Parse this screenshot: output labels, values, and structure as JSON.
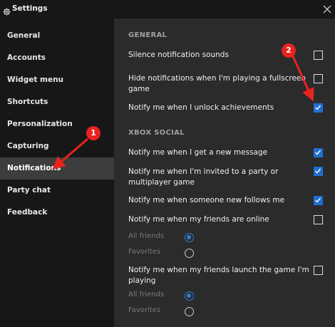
{
  "window": {
    "title": "Settings",
    "icon": "gear-icon",
    "close_icon": "close-icon"
  },
  "sidebar": {
    "items": [
      {
        "label": "General"
      },
      {
        "label": "Accounts"
      },
      {
        "label": "Widget menu"
      },
      {
        "label": "Shortcuts"
      },
      {
        "label": "Personalization"
      },
      {
        "label": "Capturing"
      },
      {
        "label": "Notifications",
        "active": true
      },
      {
        "label": "Party chat"
      },
      {
        "label": "Feedback"
      }
    ]
  },
  "general": {
    "header": "GENERAL",
    "options": [
      {
        "label": "Silence notification sounds",
        "checked": false
      },
      {
        "label": "Hide notifications when I'm playing a fullscreen game",
        "checked": false
      },
      {
        "label": "Notify me when I unlock achievements",
        "checked": true
      }
    ]
  },
  "xbox_social": {
    "header": "XBOX SOCIAL",
    "options": [
      {
        "label": "Notify me when I get a new message",
        "checked": true
      },
      {
        "label": "Notify me when I'm invited to a party or multiplayer game",
        "checked": true
      },
      {
        "label": "Notify me when someone new follows me",
        "checked": true
      },
      {
        "label": "Notify me when my friends are online",
        "checked": false
      },
      {
        "label": "Notify me when my friends launch the game I'm playing",
        "checked": false
      }
    ],
    "online_radios": [
      {
        "label": "All friends",
        "selected": true
      },
      {
        "label": "Favorites",
        "selected": false
      }
    ],
    "launch_radios": [
      {
        "label": "All friends",
        "selected": true
      },
      {
        "label": "Favorites",
        "selected": false
      }
    ]
  },
  "annotations": [
    {
      "number": "1"
    },
    {
      "number": "2"
    }
  ],
  "colors": {
    "accent": "#1e6fd0",
    "annotation": "#e8231f",
    "sidebar_bg": "#171717",
    "content_bg": "#2b2b2b"
  }
}
